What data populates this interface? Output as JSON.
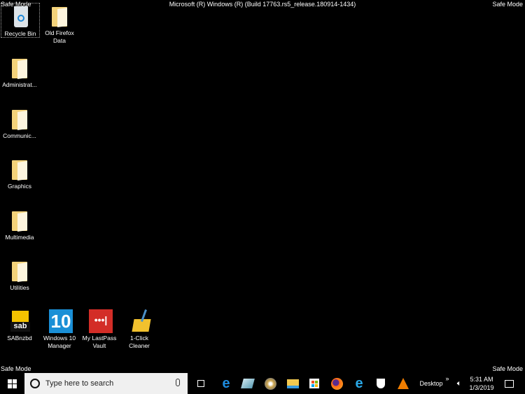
{
  "safe_mode_label": "Safe Mode",
  "title": "Microsoft (R) Windows (R) (Build 17763.rs5_release.180914-1434)",
  "desktop_icons": [
    {
      "label": "Recycle Bin",
      "icon": "recycle-bin-icon"
    },
    {
      "label": "Old Firefox Data",
      "icon": "folder-icon"
    },
    {
      "label": "Administrat...",
      "icon": "folder-icon"
    },
    {
      "label": "Communic...",
      "icon": "folder-icon"
    },
    {
      "label": "Graphics",
      "icon": "folder-icon"
    },
    {
      "label": "Multimedia",
      "icon": "folder-icon"
    },
    {
      "label": "Utilities",
      "icon": "folder-icon"
    },
    {
      "label": "SABnzbd",
      "icon": "sabnzbd-icon"
    },
    {
      "label": "Windows 10 Manager",
      "icon": "windows10-manager-icon"
    },
    {
      "label": "My LastPass Vault",
      "icon": "lastpass-icon"
    },
    {
      "label": "1-Click Cleaner",
      "icon": "cleaner-icon"
    }
  ],
  "taskbar": {
    "search_placeholder": "Type here to search",
    "pinned": [
      "task-view",
      "edge",
      "app",
      "dvd",
      "file-explorer",
      "store",
      "firefox",
      "internet-explorer",
      "security",
      "vlc"
    ],
    "toolbar_label": "Desktop",
    "overflow": "»",
    "time": "5:31 AM",
    "date": "1/3/2019"
  }
}
